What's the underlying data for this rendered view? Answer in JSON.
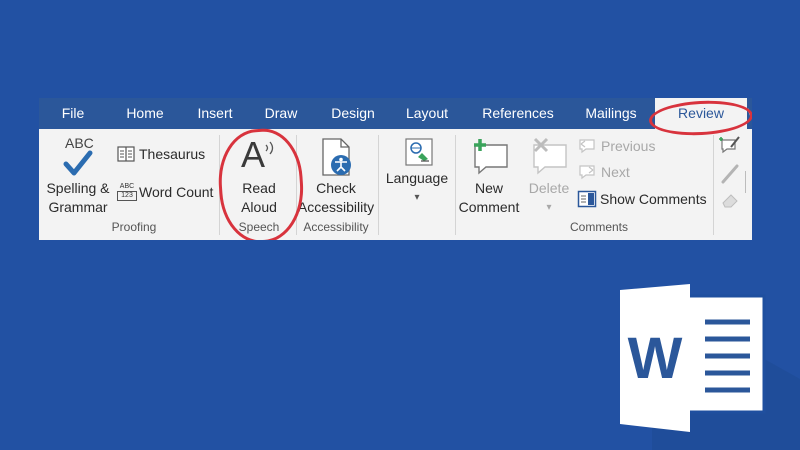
{
  "tabs": [
    {
      "label": "File"
    },
    {
      "label": "Home"
    },
    {
      "label": "Insert"
    },
    {
      "label": "Draw"
    },
    {
      "label": "Design"
    },
    {
      "label": "Layout"
    },
    {
      "label": "References"
    },
    {
      "label": "Mailings"
    },
    {
      "label": "Review"
    }
  ],
  "proofing": {
    "abc_text": "ABC",
    "spelling_line1": "Spelling &",
    "spelling_line2": "Grammar",
    "thesaurus": "Thesaurus",
    "word_count": "Word Count",
    "word_count_icon_top": "ABC",
    "word_count_icon_bottom": "123",
    "group_label": "Proofing"
  },
  "speech": {
    "read_line1": "Read",
    "read_line2": "Aloud",
    "group_label": "Speech"
  },
  "accessibility": {
    "line1": "Check",
    "line2": "Accessibility",
    "group_label": "Accessibility"
  },
  "language": {
    "label": "Language",
    "caret": "▾"
  },
  "comments": {
    "new_line1": "New",
    "new_line2": "Comment",
    "delete": "Delete",
    "delete_caret": "▾",
    "previous": "Previous",
    "next": "Next",
    "show_comments": "Show Comments",
    "group_label": "Comments"
  },
  "logo": {
    "letter": "W"
  },
  "colors": {
    "background": "#2251a3",
    "tabbar": "#2b579a",
    "ribbon": "#f3f3f3",
    "annotation": "#d8333d",
    "accent_check": "#2b6cb0",
    "accent_green": "#3aa35b"
  }
}
